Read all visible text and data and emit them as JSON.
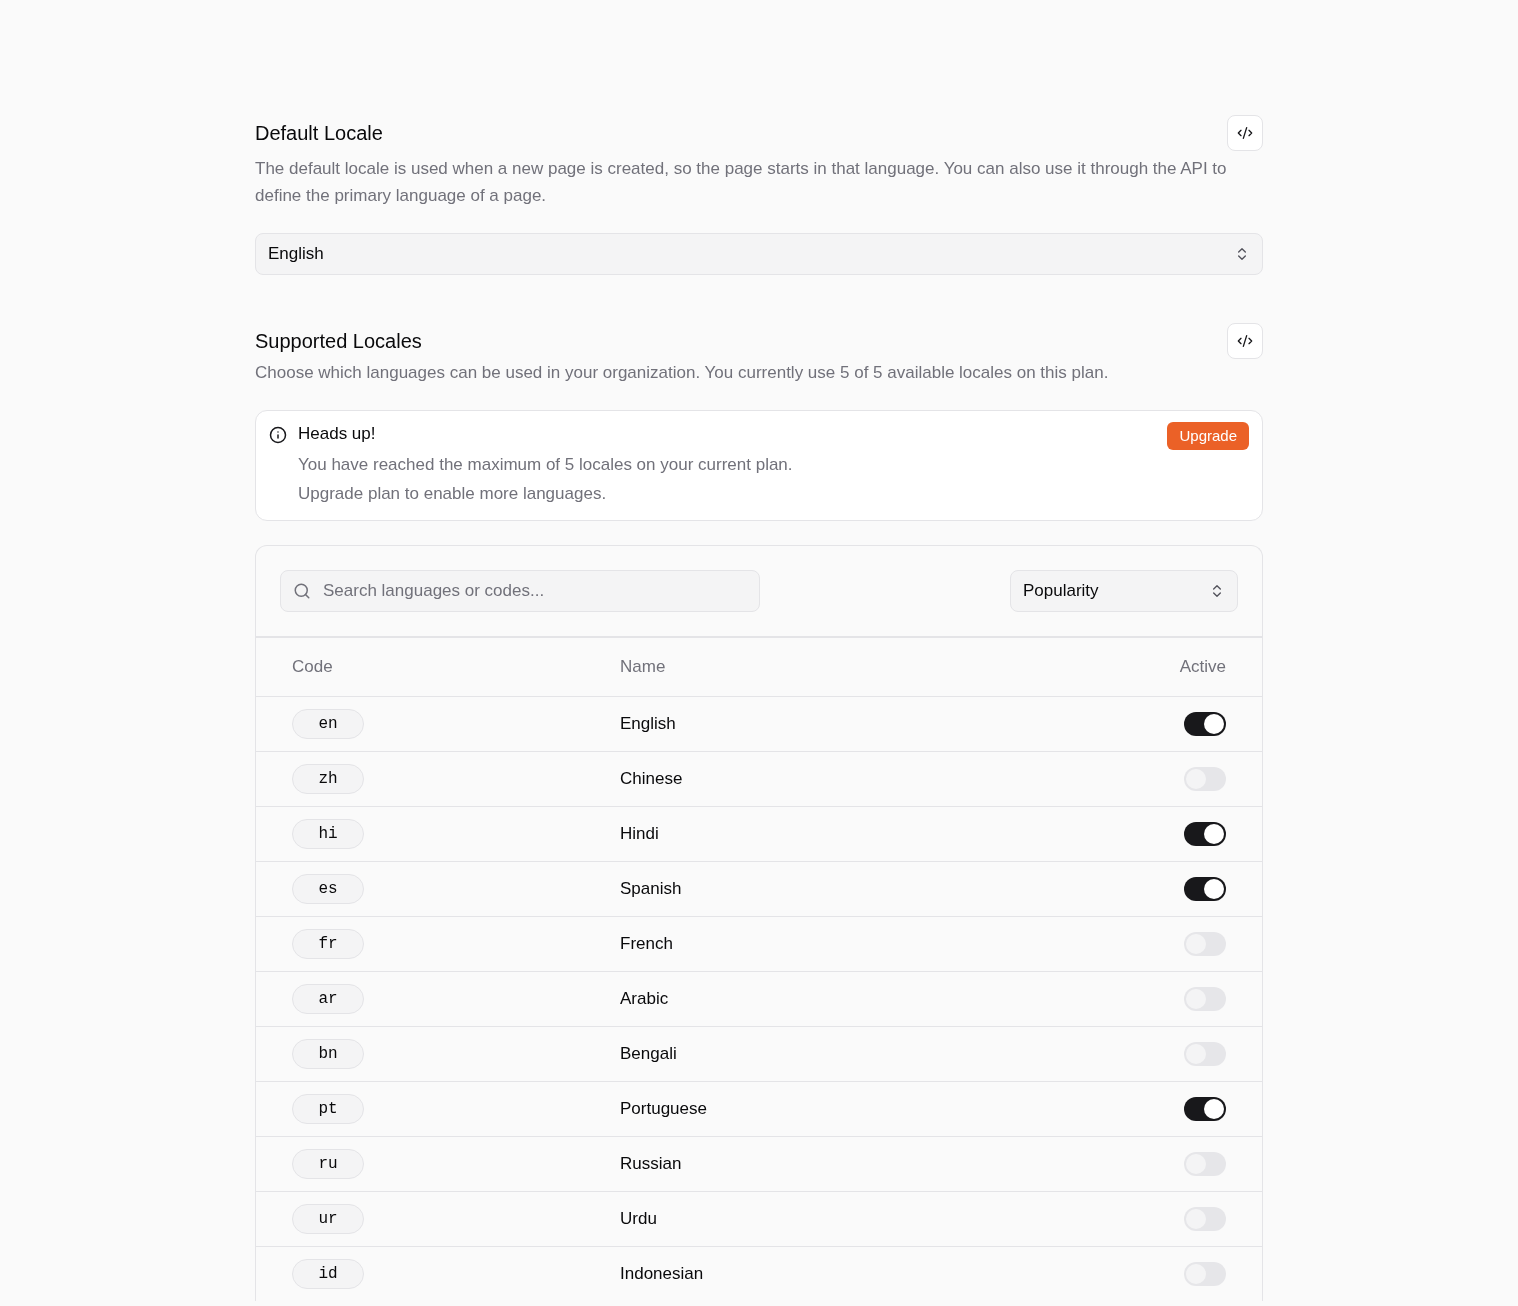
{
  "default_locale": {
    "title": "Default Locale",
    "description": "The default locale is used when a new page is created, so the page starts in that language. You can also use it through the API to define the primary language of a page.",
    "select": {
      "value": "English"
    }
  },
  "supported_locales": {
    "title": "Supported Locales",
    "description": "Choose which languages can be used in your organization. You currently use 5 of 5 available locales on this plan.",
    "alert": {
      "title": "Heads up!",
      "lines": [
        "You have reached the maximum of 5 locales on your current plan.",
        "Upgrade plan to enable more languages."
      ],
      "action": "Upgrade"
    },
    "table": {
      "search": {
        "placeholder": "Search languages or codes..."
      },
      "sort": {
        "value": "Popularity"
      },
      "columns": [
        "Code",
        "Name",
        "Active"
      ],
      "rows": [
        {
          "code": "en",
          "name": "English",
          "on": true
        },
        {
          "code": "zh",
          "name": "Chinese",
          "on": false
        },
        {
          "code": "hi",
          "name": "Hindi",
          "on": true
        },
        {
          "code": "es",
          "name": "Spanish",
          "on": true
        },
        {
          "code": "fr",
          "name": "French",
          "on": false
        },
        {
          "code": "ar",
          "name": "Arabic",
          "on": false
        },
        {
          "code": "bn",
          "name": "Bengali",
          "on": false
        },
        {
          "code": "pt",
          "name": "Portuguese",
          "on": true
        },
        {
          "code": "ru",
          "name": "Russian",
          "on": false
        },
        {
          "code": "ur",
          "name": "Urdu",
          "on": false
        },
        {
          "code": "id",
          "name": "Indonesian",
          "on": false
        }
      ]
    }
  }
}
